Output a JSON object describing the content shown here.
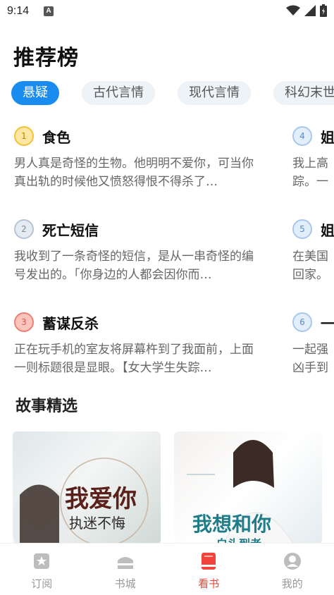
{
  "status_bar": {
    "time": "9:14",
    "notif": "A"
  },
  "page": {
    "title": "推荐榜"
  },
  "tabs": [
    {
      "label": "悬疑",
      "active": true
    },
    {
      "label": "古代言情",
      "active": false
    },
    {
      "label": "现代言情",
      "active": false
    },
    {
      "label": "科幻末世",
      "active": false
    }
  ],
  "ranking": {
    "column1": [
      {
        "rank": "1",
        "name": "食色",
        "desc": "男人真是奇怪的生物。他明明不爱你，可当你真出轨的时候他又愤怒得恨不得杀了…"
      },
      {
        "rank": "2",
        "name": "死亡短信",
        "desc": "我收到了一条奇怪的短信，是从一串奇怪的编号发出的。「你身边的人都会因你而…"
      },
      {
        "rank": "3",
        "name": "蓄谋反杀",
        "desc": "正在玩手机的室友将屏幕杵到了我面前，上面一则标题很是显眼。【女大学生失踪…"
      }
    ],
    "column2": [
      {
        "rank": "4",
        "name": "姐",
        "desc": "我上高踪。一"
      },
      {
        "rank": "5",
        "name": "姐",
        "desc": "在美国回家。"
      },
      {
        "rank": "6",
        "name": "一",
        "desc": "一起强凶手到"
      }
    ]
  },
  "stories": {
    "title": "故事精选",
    "cards": [
      {
        "title": "我爱你",
        "subtitle": "执迷不悔"
      },
      {
        "title": "我想和你",
        "subtitle": "白头到老"
      }
    ]
  },
  "tabbar": [
    {
      "label": "订阅",
      "icon": "subscribe-icon",
      "active": false
    },
    {
      "label": "书城",
      "icon": "bookstore-icon",
      "active": false
    },
    {
      "label": "看书",
      "icon": "book-icon",
      "active": true
    },
    {
      "label": "我的",
      "icon": "profile-icon",
      "active": false
    }
  ],
  "colors": {
    "accent": "#1a8cf0",
    "active_tab": "#f0443a"
  }
}
